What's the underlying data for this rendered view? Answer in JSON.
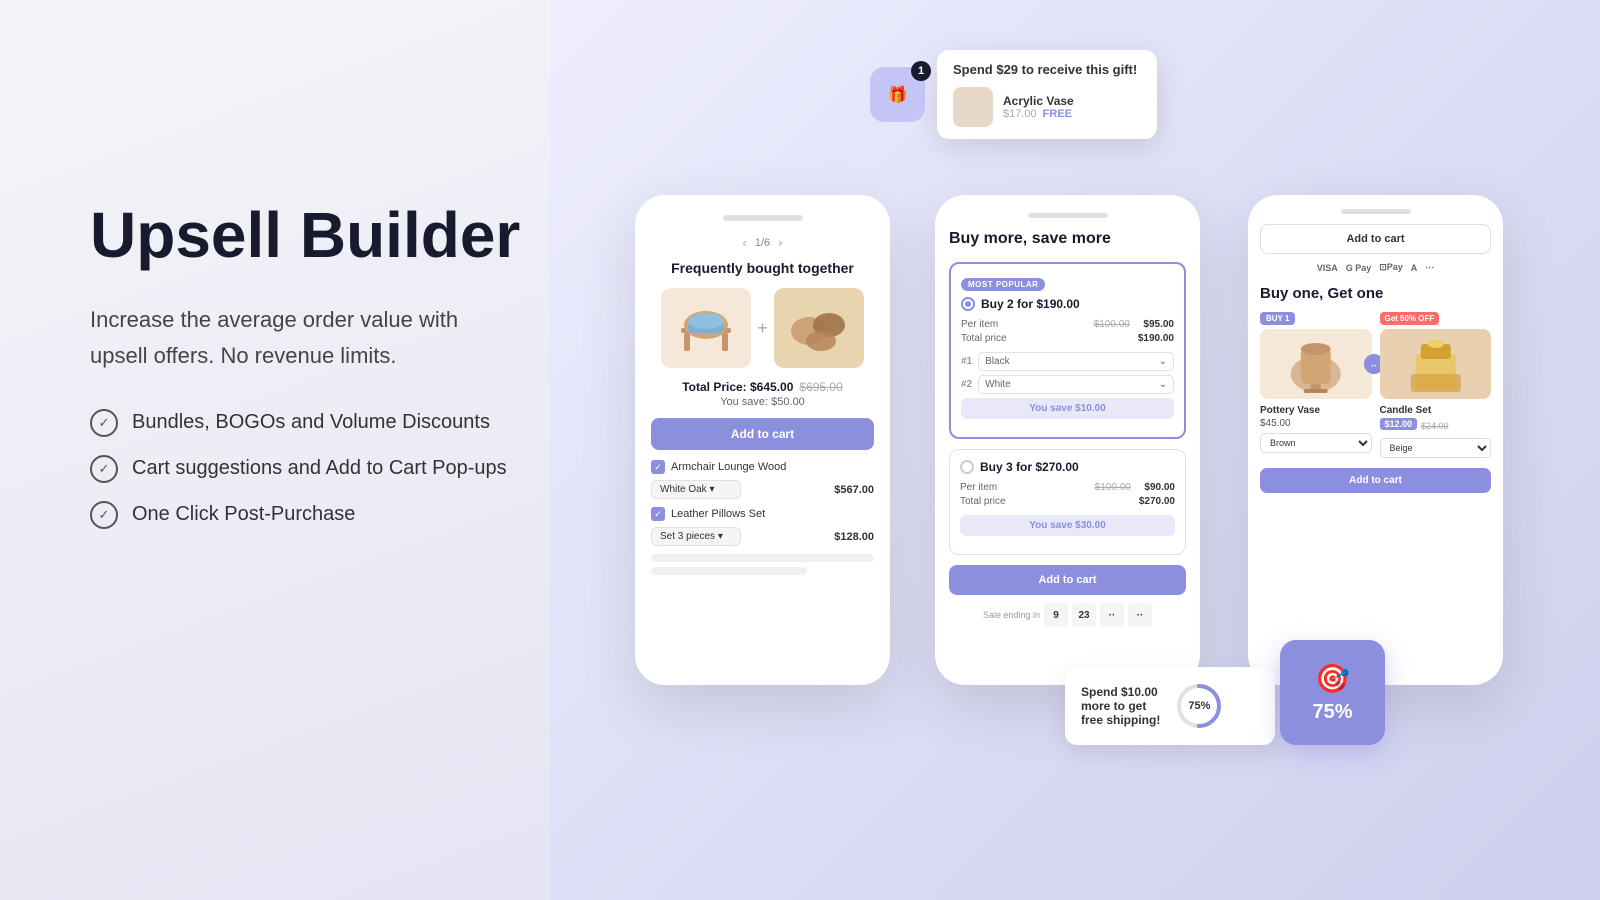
{
  "page": {
    "title": "Upsell Builder",
    "subtitle_line1": "Increase the average order value with",
    "subtitle_line2": "upsell offers. No revenue limits.",
    "features": [
      "Bundles, BOGOs and Volume Discounts",
      "Cart suggestions and Add to Cart Pop-ups",
      "One Click Post-Purchase"
    ]
  },
  "gift_notification": {
    "notification_count": "1",
    "spend_text": "Spend $29 to receive this gift!",
    "product_name": "Acrylic Vase",
    "original_price": "$17.00",
    "free_label": "FREE"
  },
  "phone1": {
    "title": "Frequently bought together",
    "nav_label": "1/6",
    "total_price_label": "Total Price: $645.00",
    "original_price": "$695.00",
    "you_save": "You save: $50.00",
    "add_to_cart": "Add to cart",
    "product1": {
      "name": "Armchair Lounge Wood",
      "variant": "White Oak",
      "price": "$567.00"
    },
    "product2": {
      "name": "Leather Pillows Set",
      "variant": "Set 3 pieces",
      "price": "$128.00"
    }
  },
  "phone2": {
    "title": "Buy more, save more",
    "offer1": {
      "badge": "MOST POPULAR",
      "label": "Buy 2 for $190.00",
      "per_item_label": "Per item",
      "per_item_original": "$100.00",
      "per_item_price": "$95.00",
      "total_label": "Total price",
      "total_price": "$190.00",
      "variant1_num": "#1",
      "variant1_value": "Black",
      "variant2_num": "#2",
      "variant2_value": "White",
      "you_save": "You save $10.00"
    },
    "offer2": {
      "label": "Buy 3 for $270.00",
      "per_item_label": "Per item",
      "per_item_original": "$100.00",
      "per_item_price": "$90.00",
      "total_label": "Total price",
      "total_price": "$270.00",
      "you_save": "You save $30.00"
    },
    "add_to_cart": "Add to cart",
    "sale_ends_label": "Sale ending in"
  },
  "phone3": {
    "add_to_cart_top": "Add to cart",
    "payment_methods": [
      "VISA",
      "G Pay",
      "⊡Pay",
      "A",
      "⋮···"
    ],
    "bogo_title": "Buy one, Get one",
    "buy1_badge": "BUY 1",
    "get50_badge": "Get 50% OFF",
    "product1": {
      "name": "Pottery Vase",
      "price": "$45.00",
      "select_value": "Brown"
    },
    "product2": {
      "name": "Candle Set",
      "original_price": "$24.00",
      "price": "$12.00",
      "select_value": "Beige"
    },
    "add_to_cart_btn": "Add to cart"
  },
  "shipping_widget": {
    "text_line1": "Spend $10.00",
    "text_line2": "more to get",
    "text_bold": "free shipping!",
    "progress": 75,
    "progress_label": "75%"
  },
  "goal_widget": {
    "percent": "75%"
  }
}
